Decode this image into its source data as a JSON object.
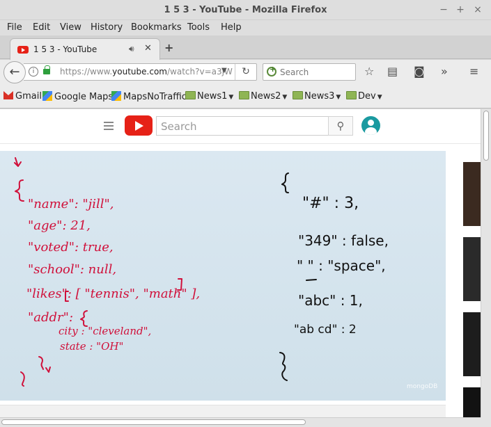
{
  "window": {
    "title": "1 5 3 - YouTube - Mozilla Firefox"
  },
  "menu": [
    "File",
    "Edit",
    "View",
    "History",
    "Bookmarks",
    "Tools",
    "Help"
  ],
  "tab": {
    "title": "1 5 3 - YouTube"
  },
  "nav": {
    "url_host": "https://www.",
    "url_domain": "youtube.com",
    "url_path": "/watch?v=a3jW",
    "search_placeholder": "Search"
  },
  "bookmarks": [
    "Gmail",
    "Google Maps",
    "MapsNoTraffic",
    "News1",
    "News2",
    "News3",
    "Dev"
  ],
  "youtube": {
    "search_placeholder": "Search"
  },
  "video": {
    "watermark": "mongoDB"
  },
  "colors": {
    "accent": "#e62117",
    "ink_red": "#d0103a",
    "ink_black": "#111111"
  }
}
